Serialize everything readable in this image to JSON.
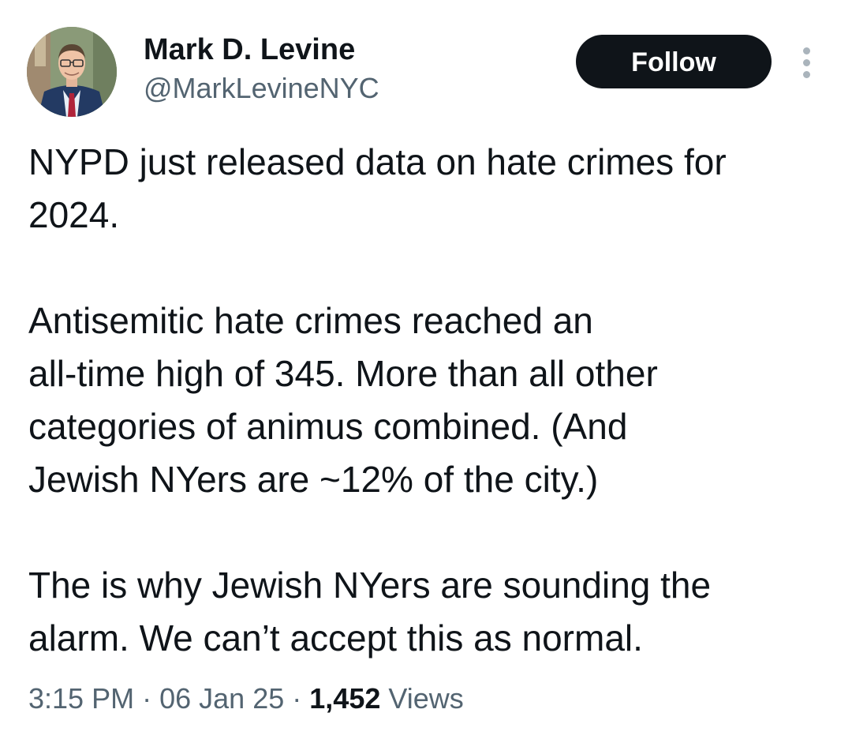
{
  "author": {
    "name": "Mark D. Levine",
    "handle": "@MarkLevineNYC",
    "avatar_icon": "person-avatar"
  },
  "actions": {
    "follow_label": "Follow",
    "more_icon": "vertical-ellipsis-icon"
  },
  "tweet": {
    "paragraphs": [
      [
        "NYPD just released data on hate crimes for",
        "2024."
      ],
      [
        "Antisemitic hate crimes reached an",
        "all-time high of 345. More than all other",
        "categories of animus combined. (And",
        "Jewish NYers are ~12% of the city.)"
      ],
      [
        "The is why Jewish NYers are sounding the",
        "alarm. We can’t accept this as normal."
      ]
    ]
  },
  "meta": {
    "time": "3:15 PM",
    "separator": "·",
    "date": "06 Jan 25",
    "views_count": "1,452",
    "views_label": "Views"
  },
  "colors": {
    "text": "#0f1419",
    "secondary": "#536471",
    "button_bg": "#0f1419",
    "button_text": "#ffffff"
  }
}
